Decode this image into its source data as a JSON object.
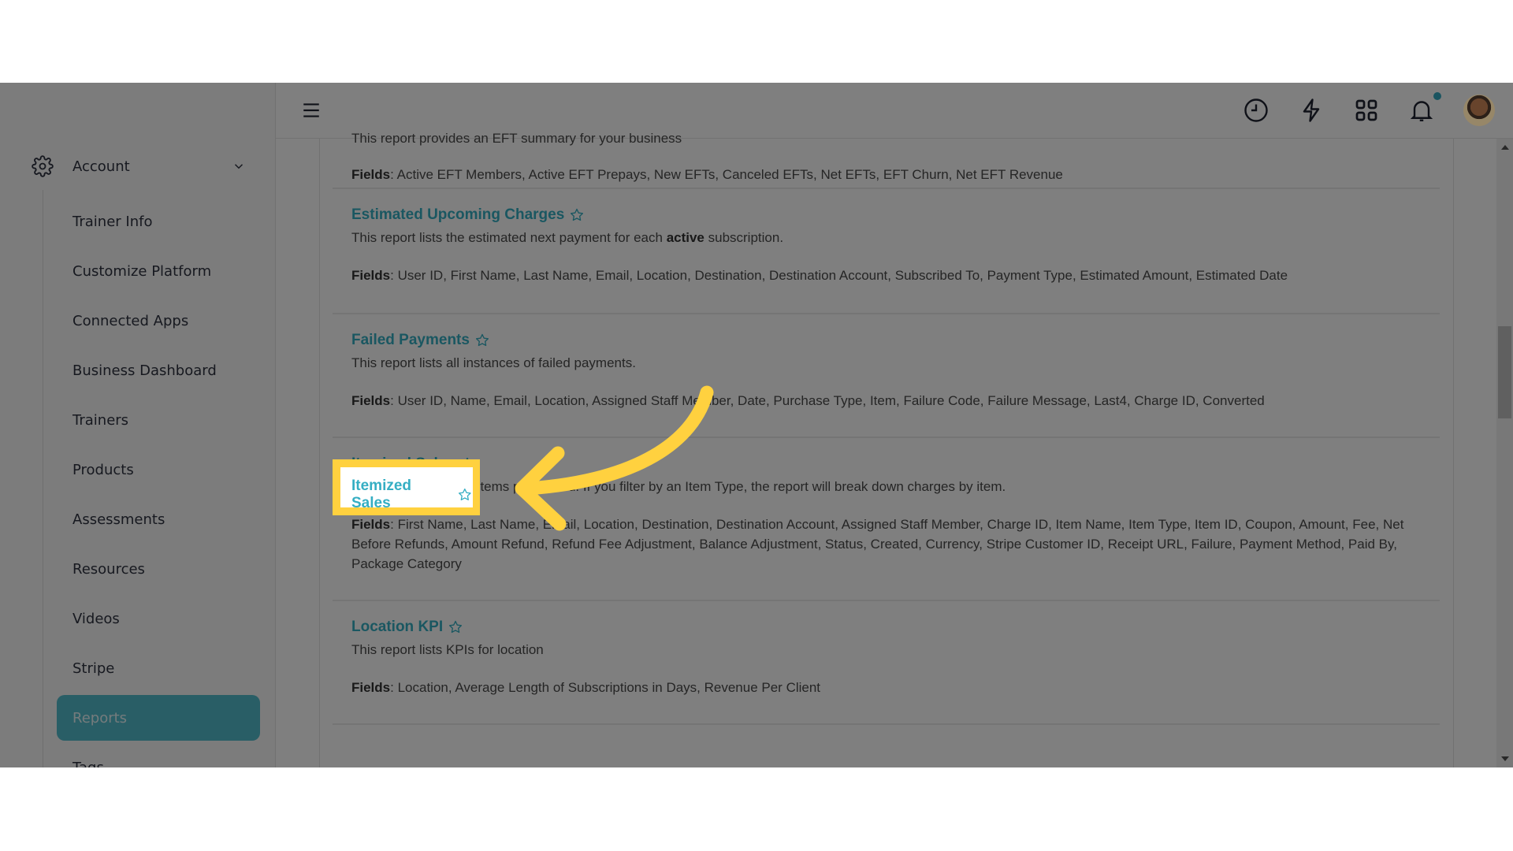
{
  "sidebar": {
    "section_label": "Account",
    "section_icon": "gear-icon",
    "items": [
      {
        "label": "Trainer Info"
      },
      {
        "label": "Customize Platform"
      },
      {
        "label": "Connected Apps"
      },
      {
        "label": "Business Dashboard"
      },
      {
        "label": "Trainers"
      },
      {
        "label": "Products"
      },
      {
        "label": "Assessments"
      },
      {
        "label": "Resources"
      },
      {
        "label": "Videos"
      },
      {
        "label": "Stripe"
      },
      {
        "label": "Reports",
        "active": true
      },
      {
        "label": "Tags"
      }
    ]
  },
  "topbar": {
    "icons": [
      "menu-icon",
      "clock-icon",
      "lightning-icon",
      "apps-grid-icon",
      "bell-icon",
      "avatar"
    ],
    "has_notification": true
  },
  "reports": {
    "fields_label": "Fields",
    "items": [
      {
        "title": "",
        "description": "This report provides an EFT summary for your business",
        "fields": "Active EFT Members, Active EFT Prepays, New EFTs, Canceled EFTs, Net EFTs, EFT Churn, Net EFT Revenue"
      },
      {
        "title": "Estimated Upcoming Charges",
        "description_before": "This report lists the estimated next payment for each ",
        "description_bold": "active",
        "description_after": " subscription.",
        "fields": "User ID, First Name, Last Name, Email, Location, Destination, Destination Account, Subscribed To, Payment Type, Estimated Amount, Estimated Date"
      },
      {
        "title": "Failed Payments",
        "description": "This report lists all instances of failed payments.",
        "fields": "User ID, Name, Email, Location, Assigned Staff Member, Date, Purchase Type, Item, Failure Code, Failure Message, Last4, Charge ID, Converted"
      },
      {
        "title": "Itemized Sales",
        "description": "An itemized list of all items purchased. If you filter by an Item Type, the report will break down charges by item.",
        "fields": "First Name, Last Name, Email, Location, Destination, Destination Account, Assigned Staff Member, Charge ID, Item Name, Item Type, Item ID, Coupon, Amount, Fee, Net Before Refunds, Amount Refund, Refund Fee Adjustment, Balance Adjustment, Status, Created, Currency, Stripe Customer ID, Receipt URL, Failure, Payment Method, Paid By, Package Category"
      },
      {
        "title": "Location KPI",
        "description": "This report lists KPIs for location",
        "fields": "Location, Average Length of Subscriptions in Days, Revenue Per Client"
      }
    ]
  },
  "highlight": {
    "target": "Itemized Sales",
    "color": "#ffd13f"
  },
  "colors": {
    "accent": "#35aec3",
    "active_nav": "#52bccd",
    "notification_dot": "#33a9c0"
  }
}
